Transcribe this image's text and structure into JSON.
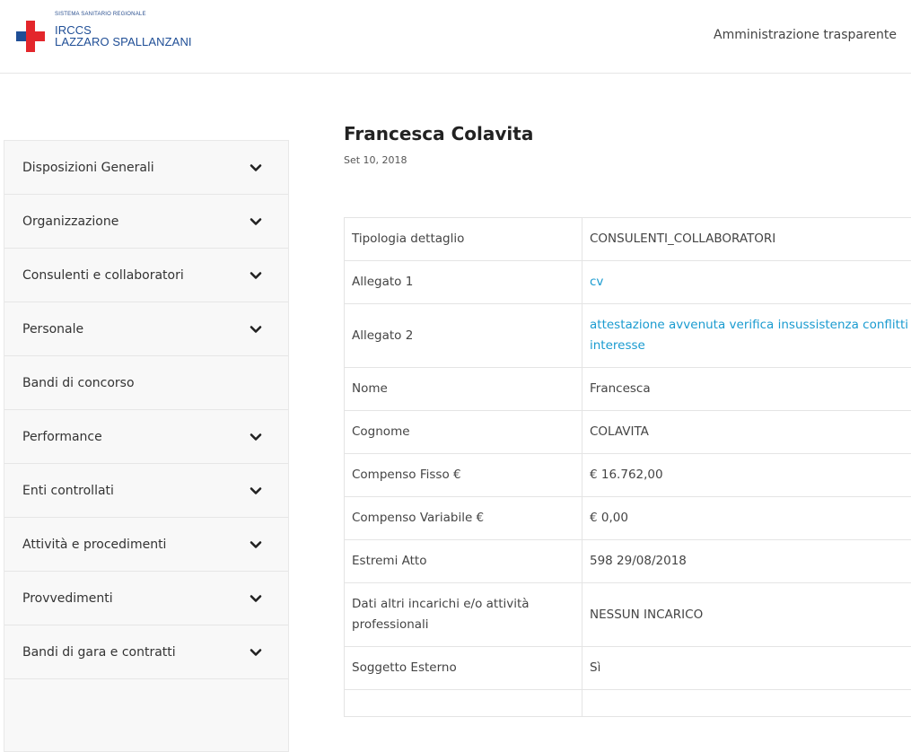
{
  "header": {
    "logo_small": "SISTEMA SANITARIO REGIONALE",
    "logo_line1": "IRCCS",
    "logo_line2": "LAZZARO SPALLANZANI",
    "nav_link": "Amministrazione trasparente",
    "brand_red": "#e3262b",
    "brand_blue": "#1f4e96"
  },
  "sidebar": {
    "items": [
      {
        "label": "Disposizioni Generali",
        "chevron": true
      },
      {
        "label": "Organizzazione",
        "chevron": true
      },
      {
        "label": "Consulenti e collaboratori",
        "chevron": true
      },
      {
        "label": "Personale",
        "chevron": true
      },
      {
        "label": "Bandi di concorso",
        "chevron": false
      },
      {
        "label": "Performance",
        "chevron": true
      },
      {
        "label": "Enti controllati",
        "chevron": true
      },
      {
        "label": "Attività e procedimenti",
        "chevron": true
      },
      {
        "label": "Provvedimenti",
        "chevron": true
      },
      {
        "label": "Bandi di gara e contratti",
        "chevron": true
      },
      {
        "label": "",
        "chevron": false
      }
    ]
  },
  "main": {
    "title": "Francesca Colavita",
    "date": "Set 10, 2018",
    "link_color": "#1a9bd0",
    "rows": [
      {
        "key": "Tipologia dettaglio",
        "value": "CONSULENTI_COLLABORATORI",
        "link": false
      },
      {
        "key": "Allegato 1",
        "value": "cv",
        "link": true
      },
      {
        "key": "Allegato 2",
        "value": "attestazione avvenuta verifica insussistenza conflitti interesse",
        "link": true
      },
      {
        "key": "Nome",
        "value": "Francesca",
        "link": false
      },
      {
        "key": "Cognome",
        "value": "COLAVITA",
        "link": false
      },
      {
        "key": "Compenso Fisso €",
        "value": "€ 16.762,00",
        "link": false
      },
      {
        "key": "Compenso Variabile €",
        "value": "€ 0,00",
        "link": false
      },
      {
        "key": "Estremi Atto",
        "value": "598 29/08/2018",
        "link": false
      },
      {
        "key": "Dati altri incarichi e/o attività professionali",
        "value": "NESSUN INCARICO",
        "link": false
      },
      {
        "key": "Soggetto Esterno",
        "value": "Sì",
        "link": false
      },
      {
        "key": "",
        "value": "",
        "link": false
      }
    ]
  }
}
